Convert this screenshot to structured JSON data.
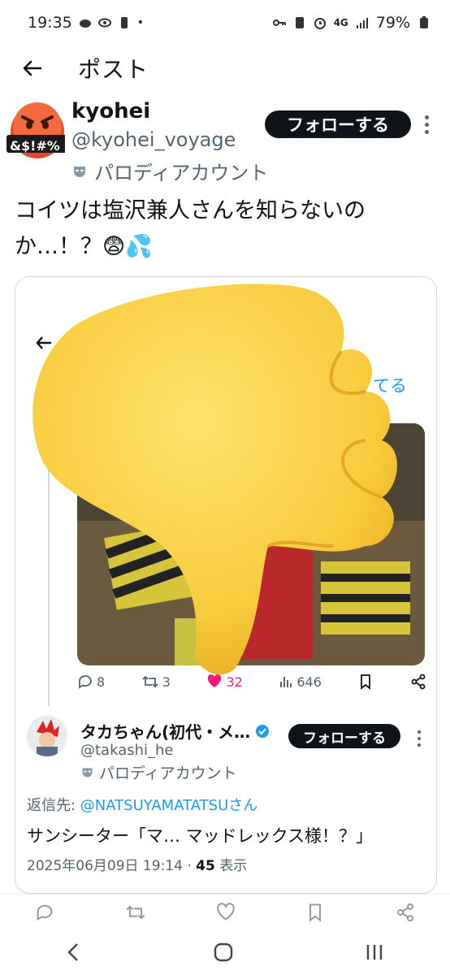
{
  "status_bar": {
    "time": "19:35",
    "battery": "79%",
    "network": "4G"
  },
  "header": {
    "title": "ポスト"
  },
  "post": {
    "author_name": "kyohei",
    "author_handle": "@kyohei_voyage",
    "parody_label": "パロディアカウント",
    "avatar_text": "&$!#%",
    "follow_label": "フォローする",
    "text_line1": "コイツは塩沢兼人さんを知らないの",
    "text_line2": "か…！？😨💦"
  },
  "quote": {
    "link_fragment": "てる",
    "stats": {
      "replies": "8",
      "reposts": "3",
      "likes": "32",
      "views": "646"
    }
  },
  "reply": {
    "name": "タカちゃん(初代・メ…",
    "handle": "@takashi_he",
    "parody_label": "パロディアカウント",
    "follow_label": "フォローする",
    "reply_to_prefix": "返信先: ",
    "reply_to_mention": "@NATSUYAMATATSUさん",
    "text": "サンシーター「マ… マッドレックス様！？」",
    "timestamp": "2025年06月09日 19:14 · ",
    "views_count": "45",
    "views_label": " 表示"
  },
  "colors": {
    "accent": "#1d9bf0",
    "like": "#f91880",
    "text": "#0f1419",
    "muted": "#536471"
  },
  "icons": [
    "back-arrow-icon",
    "kebab-icon",
    "mask-icon",
    "reply-icon",
    "repost-icon",
    "heart-icon",
    "views-icon",
    "bookmark-icon",
    "share-icon",
    "verified-icon",
    "thumbs-down-icon"
  ]
}
